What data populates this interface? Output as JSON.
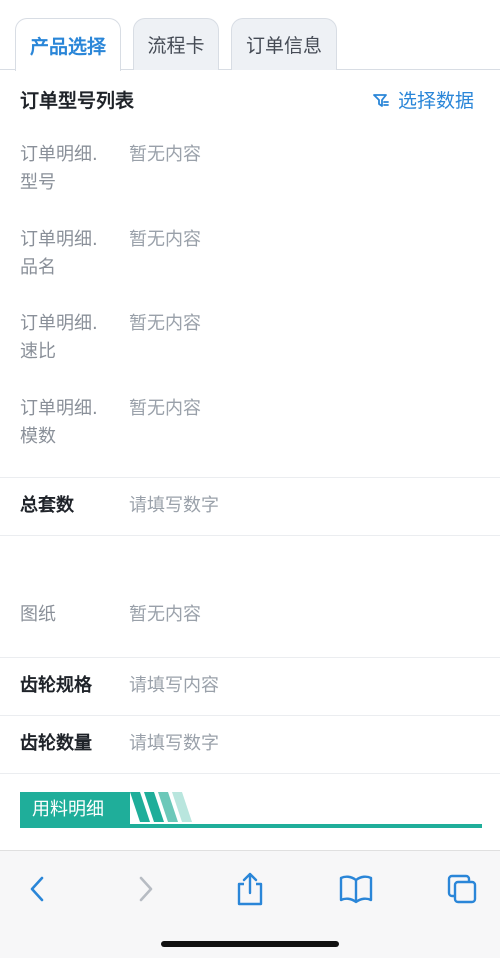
{
  "tabs": [
    {
      "label": "产品选择",
      "active": true
    },
    {
      "label": "流程卡",
      "active": false
    },
    {
      "label": "订单信息",
      "active": false
    }
  ],
  "section": {
    "title": "订单型号列表",
    "action_label": "选择数据",
    "action_icon": "select-data-icon"
  },
  "details": [
    {
      "label": "订单明细.型号",
      "value": "暂无内容"
    },
    {
      "label": "订单明细.品名",
      "value": "暂无内容"
    },
    {
      "label": "订单明细.速比",
      "value": "暂无内容"
    },
    {
      "label": "订单明细.模数",
      "value": "暂无内容"
    }
  ],
  "fields": {
    "total_sets": {
      "label": "总套数",
      "placeholder": "请填写数字"
    },
    "drawing": {
      "label": "图纸",
      "value": "暂无内容"
    },
    "gear_spec": {
      "label": "齿轮规格",
      "placeholder": "请填写内容"
    },
    "gear_qty": {
      "label": "齿轮数量",
      "placeholder": "请填写数字"
    }
  },
  "banner": {
    "label": "用料明细"
  },
  "colors": {
    "accent": "#2a86d8",
    "teal": "#1fae9a",
    "teal_light": "#9fdcd2"
  },
  "toolbar": {
    "icons": [
      "back-icon",
      "forward-icon",
      "share-icon",
      "bookmarks-icon",
      "tabs-icon"
    ]
  }
}
